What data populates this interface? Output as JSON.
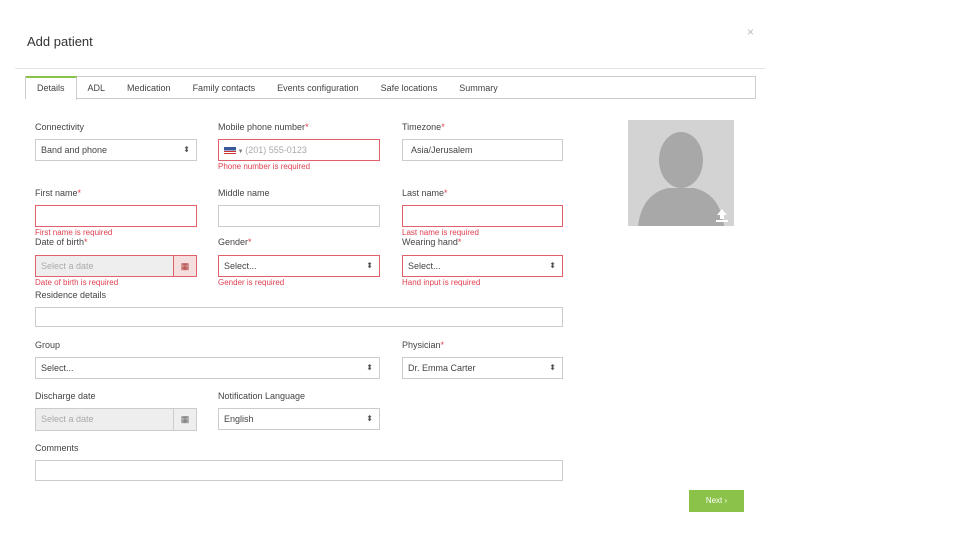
{
  "dialog": {
    "title": "Add patient",
    "close": "×"
  },
  "tabs": [
    "Details",
    "ADL",
    "Medication",
    "Family contacts",
    "Events configuration",
    "Safe locations",
    "Summary"
  ],
  "form": {
    "connectivity": {
      "label": "Connectivity",
      "value": "Band and phone"
    },
    "mobile": {
      "label": "Mobile phone number",
      "placeholder": "(201) 555-0123",
      "error": "Phone number is required",
      "country": "US"
    },
    "timezone": {
      "label": "Timezone",
      "value": "Asia/Jerusalem"
    },
    "first_name": {
      "label": "First name",
      "value": "",
      "error": "First name is required"
    },
    "middle_name": {
      "label": "Middle name",
      "value": ""
    },
    "last_name": {
      "label": "Last name",
      "value": "",
      "error": "Last name is required"
    },
    "dob": {
      "label": "Date of birth",
      "placeholder": "Select a date",
      "error": "Date of birth is required"
    },
    "gender": {
      "label": "Gender",
      "value": "Select...",
      "error": "Gender is required"
    },
    "hand": {
      "label": "Wearing hand",
      "value": "Select...",
      "error": "Hand input is required"
    },
    "residence": {
      "label": "Residence details",
      "value": ""
    },
    "group": {
      "label": "Group",
      "value": "Select..."
    },
    "physician": {
      "label": "Physician",
      "value": "Dr. Emma Carter"
    },
    "discharge": {
      "label": "Discharge date",
      "placeholder": "Select a date"
    },
    "language": {
      "label": "Notification Language",
      "value": "English"
    },
    "comments": {
      "label": "Comments",
      "value": ""
    },
    "required_mark": "*"
  },
  "next_label": "Next ›",
  "accent": "#8bc34a",
  "error_color": "#e04050"
}
